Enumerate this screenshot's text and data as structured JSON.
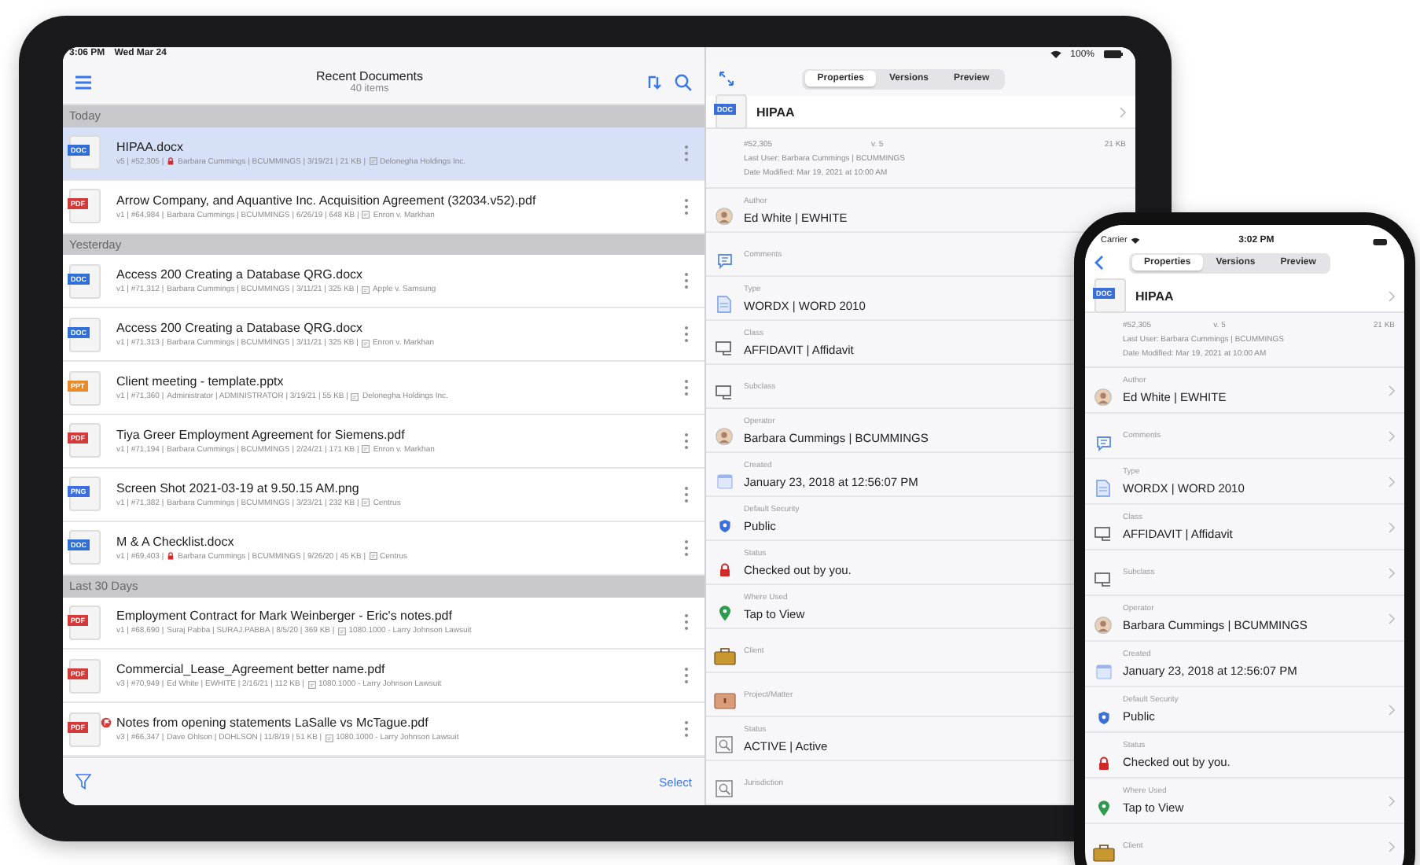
{
  "tablet": {
    "status_bar": {
      "time": "3:06 PM",
      "date": "Wed Mar 24",
      "battery": "100%"
    },
    "list": {
      "title": "Recent Documents",
      "count": "40 items",
      "footer_action": "Select",
      "groups": [
        {
          "label": "Today",
          "rows": [
            {
              "badge": "DOC",
              "color": "#2f6fd6",
              "name": "HIPAA.docx",
              "version": "v5 | #52,305 |",
              "locked": true,
              "owner": "Barbara Cummings | BCUMMINGS | 3/19/21 | 21 KB |",
              "matter": "Delonegha Holdings Inc.",
              "flagged": false,
              "selected": true
            },
            {
              "badge": "PDF",
              "color": "#d33a3a",
              "name": "Arrow Company, and Aquantive Inc. Acquisition Agreement (32034.v52).pdf",
              "version": "v1 | #64,984 |",
              "locked": false,
              "owner": "Barbara Cummings | BCUMMINGS | 6/26/19 | 648 KB |",
              "matter": "Enron v. Markhan",
              "flagged": false,
              "selected": false
            }
          ]
        },
        {
          "label": "Yesterday",
          "rows": [
            {
              "badge": "DOC",
              "color": "#2f6fd6",
              "name": "Access 200 Creating a Database QRG.docx",
              "version": "v1 | #71,312 |",
              "locked": false,
              "owner": "Barbara Cummings | BCUMMINGS | 3/11/21 | 325 KB |",
              "matter": "Apple v. Samsung",
              "flagged": false,
              "selected": false
            },
            {
              "badge": "DOC",
              "color": "#2f6fd6",
              "name": "Access 200 Creating a Database QRG.docx",
              "version": "v1 | #71,313 |",
              "locked": false,
              "owner": "Barbara Cummings | BCUMMINGS | 3/11/21 | 325 KB |",
              "matter": "Enron v. Markhan",
              "flagged": false,
              "selected": false
            },
            {
              "badge": "PPT",
              "color": "#e8892a",
              "name": "Client meeting - template.pptx",
              "version": "v1 | #71,360 |",
              "locked": false,
              "owner": "Administrator | ADMINISTRATOR | 3/19/21 | 55 KB |",
              "matter": "Delonegha Holdings Inc.",
              "flagged": false,
              "selected": false
            },
            {
              "badge": "PDF",
              "color": "#d33a3a",
              "name": "Tiya Greer Employment Agreement for Siemens.pdf",
              "version": "v1 | #71,194 |",
              "locked": false,
              "owner": "Barbara Cummings | BCUMMINGS | 2/24/21 | 171 KB |",
              "matter": "Enron v. Markhan",
              "flagged": false,
              "selected": false
            },
            {
              "badge": "PNG",
              "color": "#3b6fe0",
              "name": "Screen Shot 2021-03-19 at 9.50.15 AM.png",
              "version": "v1 | #71,382 |",
              "locked": false,
              "owner": "Barbara Cummings | BCUMMINGS | 3/23/21 | 232 KB |",
              "matter": "Centrus",
              "flagged": false,
              "selected": false
            },
            {
              "badge": "DOC",
              "color": "#2f6fd6",
              "name": "M & A Checklist.docx",
              "version": "v1 | #69,403 |",
              "locked": true,
              "owner": "Barbara Cummings | BCUMMINGS | 9/26/20 | 45 KB |",
              "matter": "Centrus",
              "flagged": false,
              "selected": false
            }
          ]
        },
        {
          "label": "Last 30 Days",
          "rows": [
            {
              "badge": "PDF",
              "color": "#d33a3a",
              "name": "Employment Contract for Mark Weinberger - Eric's notes.pdf",
              "version": "v1 | #68,690 |",
              "locked": false,
              "owner": "Suraj Pabba | SURAJ.PABBA | 8/5/20 | 369 KB |",
              "matter": "1080.1000 - Larry Johnson Lawsuit",
              "flagged": false,
              "selected": false
            },
            {
              "badge": "PDF",
              "color": "#d33a3a",
              "name": "Commercial_Lease_Agreement better name.pdf",
              "version": "v3 | #70,949 |",
              "locked": false,
              "owner": "Ed White | EWHITE | 2/16/21 | 112 KB |",
              "matter": "1080.1000 - Larry Johnson Lawsuit",
              "flagged": false,
              "selected": false
            },
            {
              "badge": "PDF",
              "color": "#d33a3a",
              "name": "Notes from opening statements LaSalle vs McTague.pdf",
              "version": "v3 | #66,347 |",
              "locked": false,
              "owner": "Dave Ohlson | DOHLSON | 11/8/19 | 51 KB |",
              "matter": "1080.1000 - Larry Johnson Lawsuit",
              "flagged": true,
              "selected": false
            }
          ]
        }
      ]
    },
    "detail": {
      "tabs": [
        {
          "label": "Properties",
          "selected": true
        },
        {
          "label": "Versions",
          "selected": false
        },
        {
          "label": "Preview",
          "selected": false
        }
      ],
      "document": {
        "badge": "DOC",
        "name": "HIPAA",
        "id": "#52,305",
        "version": "v. 5",
        "size": "21 KB",
        "last_user": "Last User: Barbara Cummings | BCUMMINGS",
        "modified": "Date Modified: Mar 19, 2021 at 10:00 AM"
      },
      "properties": [
        {
          "kind": "person",
          "label": "Author",
          "value": "Ed White | EWHITE"
        },
        {
          "kind": "comment",
          "label": "Comments"
        },
        {
          "kind": "document",
          "label": "Type",
          "value": "WORDX | WORD 2010"
        },
        {
          "kind": "monitor",
          "label": "Class",
          "value": "AFFIDAVIT | Affidavit"
        },
        {
          "kind": "monitor",
          "label": "Subclass"
        },
        {
          "kind": "person",
          "label": "Operator",
          "value": "Barbara Cummings | BCUMMINGS"
        },
        {
          "kind": "calendar",
          "label": "Created",
          "value": "January 23, 2018 at 12:56:07 PM"
        },
        {
          "kind": "shield",
          "label": "Default Security",
          "value": "Public"
        },
        {
          "kind": "lock",
          "label": "Status",
          "value": "Checked out by you."
        },
        {
          "kind": "pin",
          "label": "Where Used",
          "value": "Tap to View"
        },
        {
          "kind": "briefcase",
          "label": "Client"
        },
        {
          "kind": "folder",
          "label": "Project/Matter"
        },
        {
          "kind": "search",
          "label": "Status",
          "value": "ACTIVE | Active"
        },
        {
          "kind": "search",
          "label": "Jurisdiction"
        }
      ]
    }
  },
  "phone": {
    "status_bar": {
      "carrier": "Carrier",
      "time": "3:02 PM"
    },
    "tabs": [
      {
        "label": "Properties",
        "selected": true
      },
      {
        "label": "Versions",
        "selected": false
      },
      {
        "label": "Preview",
        "selected": false
      }
    ],
    "document": {
      "badge": "DOC",
      "name": "HIPAA",
      "id": "#52,305",
      "version": "v. 5",
      "size": "21 KB",
      "last_user": "Last User: Barbara Cummings | BCUMMINGS",
      "modified": "Date Modified: Mar 19, 2021 at 10:00 AM"
    },
    "properties": [
      {
        "kind": "person",
        "label": "Author",
        "value": "Ed White | EWHITE",
        "chevron": true
      },
      {
        "kind": "comment",
        "label": "Comments",
        "chevron": true
      },
      {
        "kind": "document",
        "label": "Type",
        "value": "WORDX | WORD 2010",
        "chevron": true
      },
      {
        "kind": "monitor",
        "label": "Class",
        "value": "AFFIDAVIT | Affidavit",
        "chevron": true
      },
      {
        "kind": "monitor",
        "label": "Subclass",
        "chevron": true
      },
      {
        "kind": "person",
        "label": "Operator",
        "value": "Barbara Cummings | BCUMMINGS",
        "chevron": true
      },
      {
        "kind": "calendar",
        "label": "Created",
        "value": "January 23, 2018 at 12:56:07 PM",
        "chevron": false
      },
      {
        "kind": "shield",
        "label": "Default Security",
        "value": "Public",
        "chevron": true
      },
      {
        "kind": "lock",
        "label": "Status",
        "value": "Checked out by you.",
        "chevron": false
      },
      {
        "kind": "pin",
        "label": "Where Used",
        "value": "Tap to View",
        "chevron": true
      },
      {
        "kind": "briefcase",
        "label": "Client",
        "chevron": true
      }
    ]
  }
}
